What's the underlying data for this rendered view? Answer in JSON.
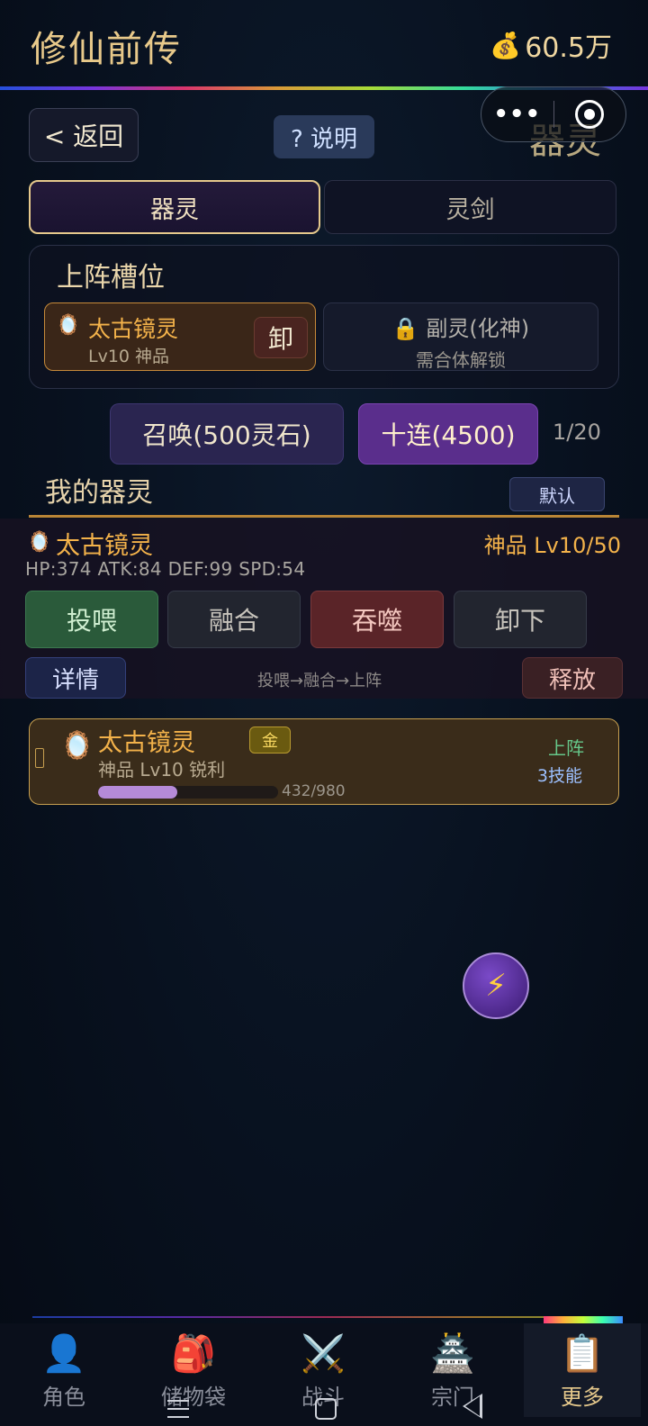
{
  "header": {
    "title": "修仙前传",
    "currency_icon": "money-bag-icon",
    "currency": "60.5万"
  },
  "capsule": {
    "more": "•••",
    "close_icon": "target-icon"
  },
  "page_heading": "器灵",
  "nav": {
    "back": "< 返回",
    "help": "? 说明"
  },
  "tabs": [
    {
      "label": "器灵",
      "active": true
    },
    {
      "label": "灵剑",
      "active": false
    }
  ],
  "slots": {
    "title": "上阵槽位",
    "main": {
      "icon": "mirror-icon",
      "name": "太古镜灵",
      "sub": "Lv10 神品",
      "unequip": "卸"
    },
    "locked": {
      "icon": "lock-icon",
      "name": "副灵(化神)",
      "sub": "需合体解锁"
    }
  },
  "summon": {
    "single": "召唤(500灵石)",
    "ten": "十连(4500)",
    "count": "1/20"
  },
  "my_spirits": {
    "title": "我的器灵",
    "sort": "默认"
  },
  "detail": {
    "icon": "mirror-icon",
    "name": "太古镜灵",
    "grade": "神品 Lv10/50",
    "stats": "HP:374 ATK:84 DEF:99 SPD:54",
    "actions": {
      "feed": "投喂",
      "fuse": "融合",
      "devour": "吞噬",
      "off": "卸下"
    },
    "details": "详情",
    "flow": "投喂→融合→上阵",
    "release": "释放"
  },
  "list": [
    {
      "icon": "mirror-icon",
      "name": "太古镜灵",
      "badge": "金",
      "sub": "神品 Lv10 锐利",
      "xp": "432/980",
      "xp_fraction": 0.44,
      "status": "上阵",
      "skills": "3技能"
    }
  ],
  "float_button": {
    "icon": "lightning-icon",
    "glyph": "⚡"
  },
  "tabbar": [
    {
      "label": "角色",
      "icon": "person-icon",
      "glyph": "👤"
    },
    {
      "label": "储物袋",
      "icon": "backpack-icon",
      "glyph": "🎒"
    },
    {
      "label": "战斗",
      "icon": "crossed-swords-icon",
      "glyph": "⚔️"
    },
    {
      "label": "宗门",
      "icon": "pagoda-icon",
      "glyph": "🏯"
    },
    {
      "label": "更多",
      "icon": "clipboard-icon",
      "glyph": "📋",
      "active": true
    }
  ]
}
